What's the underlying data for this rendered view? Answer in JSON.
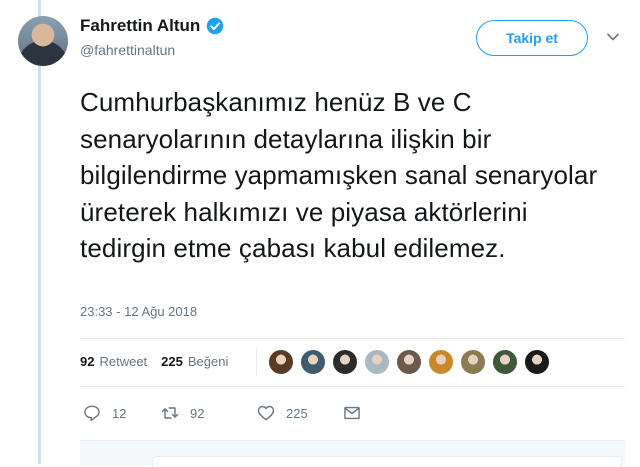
{
  "author": {
    "display_name": "Fahrettin Altun",
    "handle": "@fahrettinaltun",
    "verified_icon": "verified-badge-icon"
  },
  "follow_button_label": "Takip et",
  "tweet": {
    "text": "Cumhurbaşkanımız henüz B ve C senaryolarının detaylarına ilişkin bir bilgilendirme yapmamışken sanal senaryolar üreterek halkımızı ve piyasa aktörlerini tedirgin etme çabası kabul edilemez.",
    "timestamp": "23:33 - 12 Ağu 2018"
  },
  "stats": {
    "retweets_count": "92",
    "retweets_label": "Retweet",
    "likes_count": "225",
    "likes_label": "Beğeni"
  },
  "liker_avatars": [
    {
      "color": "#5a3a22"
    },
    {
      "color": "#3f5b6e"
    },
    {
      "color": "#2c2c2c"
    },
    {
      "color": "#aab8c2"
    },
    {
      "color": "#6b5a4a"
    },
    {
      "color": "#c9892b"
    },
    {
      "color": "#8c7a52"
    },
    {
      "color": "#3c5a3a"
    },
    {
      "color": "#1a1a1a"
    }
  ],
  "actions": {
    "reply_count": "12",
    "retweet_count": "92",
    "like_count": "225"
  },
  "colors": {
    "accent": "#1da1f2",
    "secondary_text": "#657786",
    "primary_text": "#14171a"
  }
}
